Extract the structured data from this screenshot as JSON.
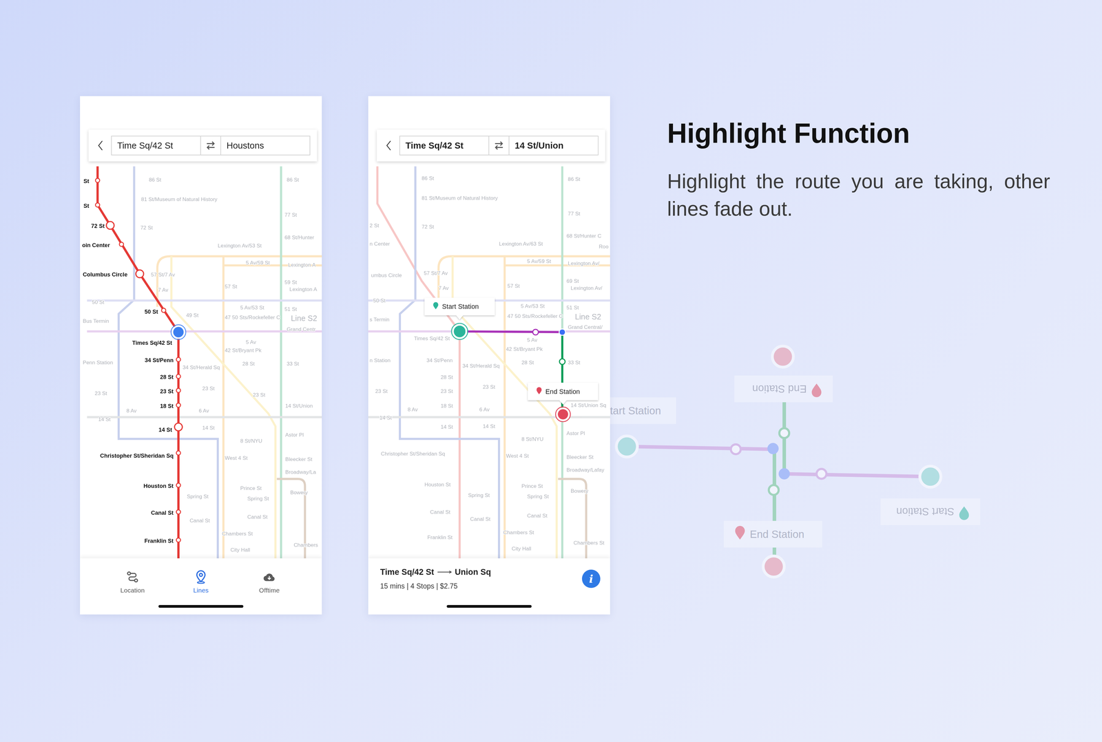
{
  "lines_screen": {
    "search": {
      "from": "Time Sq/42 St",
      "to": "Houstons"
    },
    "route": {
      "stations": [
        {
          "name": "St",
          "transfer": false,
          "current": false
        },
        {
          "name": "St",
          "transfer": false,
          "current": false
        },
        {
          "name": "72 St",
          "transfer": true,
          "current": false
        },
        {
          "name": "oin Center",
          "transfer": false,
          "current": false
        },
        {
          "name": "Columbus Circle",
          "transfer": true,
          "current": false
        },
        {
          "name": "50 St",
          "transfer": false,
          "current": false
        },
        {
          "name": "Times Sq/42 St",
          "transfer": false,
          "current": true
        },
        {
          "name": "34 St/Penn",
          "transfer": false,
          "current": false
        },
        {
          "name": "28 St",
          "transfer": false,
          "current": false
        },
        {
          "name": "23 St",
          "transfer": false,
          "current": false
        },
        {
          "name": "18 St",
          "transfer": false,
          "current": false
        },
        {
          "name": "14 St",
          "transfer": true,
          "current": false
        },
        {
          "name": "Christopher St/Sheridan Sq",
          "transfer": false,
          "current": false
        },
        {
          "name": "Houston St",
          "transfer": false,
          "current": false
        },
        {
          "name": "Canal St",
          "transfer": false,
          "current": false
        },
        {
          "name": "Franklin St",
          "transfer": false,
          "current": false
        }
      ]
    },
    "labels": [
      "86 St",
      "81 St/Museum of Natural History",
      "72 St",
      "86 St",
      "77 St",
      "68 St/Hunter",
      "Lexington Av/53 St",
      "5 Av/59 St",
      "Lexington A",
      "57 St/7 Av",
      "7 Av",
      "57 St",
      "59 St",
      "Lexington A",
      "50 St",
      "5 Av/53 St",
      "51 St",
      "49 St",
      "47 50 Sts/Rockefeller C",
      "Bus Termin",
      "Grand Centr",
      "5 Av",
      "42 St/Bryant Pk",
      "Penn Station",
      "34 St/Herald Sq",
      "28 St",
      "33 St",
      "23 St",
      "23 St",
      "23 St",
      "8 Av",
      "6 Av",
      "14 St/Union",
      "14 St",
      "14 St",
      "8 St/NYU",
      "Astor Pl",
      "West 4 St",
      "Bleecker St",
      "Broadway/La",
      "Spring St",
      "Prince St",
      "Spring St",
      "Bowery",
      "Canal St",
      "Canal St",
      "Chambers St",
      "Chambers",
      "City Hall"
    ],
    "line_names": [
      "Line S2"
    ],
    "tabs": [
      {
        "label": "Location",
        "selected": false
      },
      {
        "label": "Lines",
        "selected": true
      },
      {
        "label": "Offtime",
        "selected": false
      }
    ]
  },
  "route_screen": {
    "search": {
      "from": "Time Sq/42 St",
      "to": "14 St/Union"
    },
    "labels": [
      "86 St",
      "81 St/Museum of Natural History",
      "72 St",
      "2 St",
      "n Center",
      "umbus Circle",
      "57 St/7 Av",
      "7 Av",
      "57 St",
      "Lexington Av/63 St",
      "5 Av/59 St",
      "86 St",
      "77 St",
      "68 St/Hunter C",
      "Roo",
      "Lexington Av/",
      "69 St",
      "Lexington Av/",
      "50 St",
      "5 Av/53 St",
      "51 St",
      "47 50 Sts/Rockefeller C",
      "Grand Central/",
      "s Termin",
      "Times Sq/42 St",
      "5 Av",
      "42 St/Bryant Pk",
      "n Station",
      "34 St/Penn",
      "34 St/Herald Sq",
      "28 St",
      "33 St",
      "28 St",
      "23 St",
      "23 St",
      "23 St",
      "8 Av",
      "18 St",
      "6 Av",
      "14 St/Union Sq",
      "14 St",
      "14 St",
      "14 St",
      "8 St/NYU",
      "Astor Pl",
      "West 4 St",
      "Christopher St/Sheridan Sq",
      "Bleecker St",
      "Broadway/Lafay",
      "Houston St",
      "Prince St",
      "Spring St",
      "Spring St",
      "Bowery",
      "Canal St",
      "Canal St",
      "Canal St",
      "Franklin St",
      "Chambers St",
      "City Hall",
      "Chambers St"
    ],
    "line_names": [
      "Line S2"
    ],
    "markers": [
      {
        "label": "Start Station",
        "kind": "start"
      },
      {
        "label": "End Station",
        "kind": "end"
      }
    ],
    "summary": {
      "from": "Time Sq/42 St",
      "to": "Union Sq",
      "details": "15 mins | 4 Stops | $2.75",
      "info": "i"
    }
  },
  "feature": {
    "title": "Highlight Function",
    "description": "Highlight the route you are taking, other lines fade out."
  },
  "preview": {
    "labels": [
      {
        "text": "tart Station",
        "flipped": false
      },
      {
        "text": "End Station",
        "flipped": true
      },
      {
        "text": "Start Station",
        "flipped": true
      },
      {
        "text": "End Station",
        "flipped": false
      }
    ]
  }
}
